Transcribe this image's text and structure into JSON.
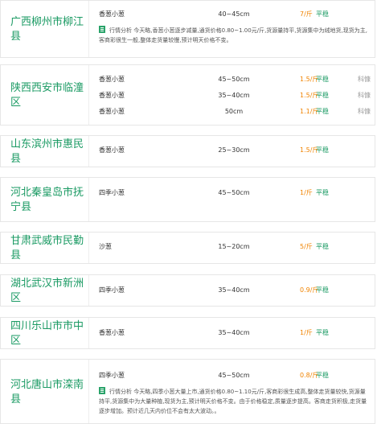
{
  "markets": [
    {
      "region": "广西柳州市柳江县",
      "rows": [
        {
          "product": "香葱小葱",
          "spec": "40~45cm",
          "price": "7/斤",
          "trend": "平稳",
          "tag": ""
        }
      ],
      "note": "行情分析 今天略,香葱小葱逐步减量,通货价格0.80~1.00元/斤,货源量持平,货源集中为绒地货,现货为主,客商彩很生一般,整体走货量较慢,预计明天价格不变。"
    },
    {
      "region": "陕西西安市临潼区",
      "rows": [
        {
          "product": "香葱小葱",
          "spec": "45~50cm",
          "price": "1.5/斤",
          "trend": "平稳",
          "tag": "科慷"
        },
        {
          "product": "香葱小葱",
          "spec": "35~40cm",
          "price": "1.5/斤",
          "trend": "平稳",
          "tag": "科慷"
        },
        {
          "product": "香葱小葱",
          "spec": "50cm",
          "price": "1.1/斤",
          "trend": "平稳",
          "tag": "科慷"
        }
      ],
      "note": ""
    },
    {
      "region": "山东滨州市惠民县",
      "rows": [
        {
          "product": "香葱小葱",
          "spec": "25~30cm",
          "price": "1.5/斤",
          "trend": "平稳",
          "tag": ""
        }
      ],
      "note": ""
    },
    {
      "region": "河北秦皇岛市抚宁县",
      "rows": [
        {
          "product": "四季小葱",
          "spec": "45~50cm",
          "price": "1/斤",
          "trend": "平稳",
          "tag": ""
        }
      ],
      "note": ""
    },
    {
      "region": "甘肃武威市民勤县",
      "rows": [
        {
          "product": "沙葱",
          "spec": "15~20cm",
          "price": "5/斤",
          "trend": "平稳",
          "tag": ""
        }
      ],
      "note": ""
    },
    {
      "region": "湖北武汉市新洲区",
      "rows": [
        {
          "product": "四季小葱",
          "spec": "35~40cm",
          "price": "0.9/斤",
          "trend": "平稳",
          "tag": ""
        }
      ],
      "note": ""
    },
    {
      "region": "四川乐山市市中区",
      "rows": [
        {
          "product": "香葱小葱",
          "spec": "35~40cm",
          "price": "1/斤",
          "trend": "平稳",
          "tag": ""
        }
      ],
      "note": ""
    },
    {
      "region": "河北唐山市滦南县",
      "rows": [
        {
          "product": "四季小葱",
          "spec": "45~50cm",
          "price": "0.8/斤",
          "trend": "平稳",
          "tag": ""
        }
      ],
      "note": "行情分析 今天略,四季小葱大量上市,通货价格0.80~1.10元/斤,客商彩很生成高,整体走货量较快,货源量持平,货源集中为大量种植,现货为主,预计明天价格不变。由于价格稳定,质量逐步提高。客商走货积极,走货量逐步增加。预计近几天内价位不会有太大波动。。"
    }
  ]
}
